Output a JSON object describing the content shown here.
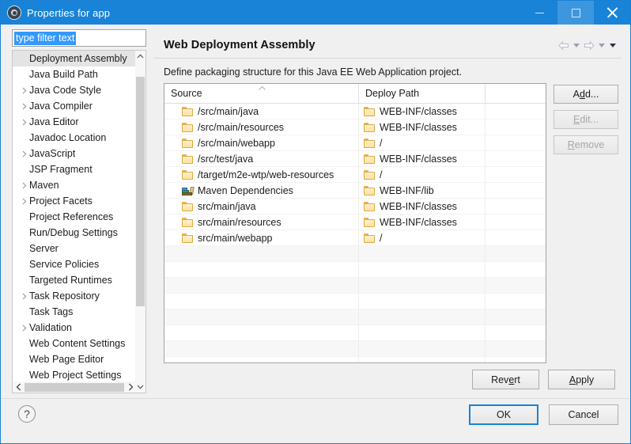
{
  "window": {
    "title": "Properties for app",
    "icon": "properties-gear-icon",
    "accent_color": "#1883d7",
    "buttons": {
      "minimize": "minimize",
      "maximize": "maximize",
      "close": "close"
    }
  },
  "filter": {
    "value": "type filter text",
    "placeholder": "type filter text"
  },
  "tree": {
    "items": [
      {
        "label": "Deployment Assembly",
        "expandable": false,
        "selected": true
      },
      {
        "label": "Java Build Path",
        "expandable": false,
        "selected": false
      },
      {
        "label": "Java Code Style",
        "expandable": true,
        "selected": false
      },
      {
        "label": "Java Compiler",
        "expandable": true,
        "selected": false
      },
      {
        "label": "Java Editor",
        "expandable": true,
        "selected": false
      },
      {
        "label": "Javadoc Location",
        "expandable": false,
        "selected": false
      },
      {
        "label": "JavaScript",
        "expandable": true,
        "selected": false
      },
      {
        "label": "JSP Fragment",
        "expandable": false,
        "selected": false
      },
      {
        "label": "Maven",
        "expandable": true,
        "selected": false
      },
      {
        "label": "Project Facets",
        "expandable": true,
        "selected": false
      },
      {
        "label": "Project References",
        "expandable": false,
        "selected": false
      },
      {
        "label": "Run/Debug Settings",
        "expandable": false,
        "selected": false
      },
      {
        "label": "Server",
        "expandable": false,
        "selected": false
      },
      {
        "label": "Service Policies",
        "expandable": false,
        "selected": false
      },
      {
        "label": "Targeted Runtimes",
        "expandable": false,
        "selected": false
      },
      {
        "label": "Task Repository",
        "expandable": true,
        "selected": false
      },
      {
        "label": "Task Tags",
        "expandable": false,
        "selected": false
      },
      {
        "label": "Validation",
        "expandable": true,
        "selected": false
      },
      {
        "label": "Web Content Settings",
        "expandable": false,
        "selected": false
      },
      {
        "label": "Web Page Editor",
        "expandable": false,
        "selected": false
      },
      {
        "label": "Web Project Settings",
        "expandable": false,
        "selected": false
      }
    ]
  },
  "page": {
    "title": "Web Deployment Assembly",
    "description": "Define packaging structure for this Java EE Web Application project.",
    "nav": {
      "back": "back-arrow-icon",
      "back_menu": "back-dropdown-icon",
      "forward": "forward-arrow-icon",
      "forward_menu": "forward-dropdown-icon",
      "view_menu": "view-menu-dropdown-icon"
    }
  },
  "table": {
    "columns": [
      "Source",
      "Deploy Path",
      ""
    ],
    "sorted_column": "Source",
    "sort_direction": "ascending",
    "rows": [
      {
        "source": "/src/main/java",
        "icon": "folder-icon",
        "deploy": "WEB-INF/classes"
      },
      {
        "source": "/src/main/resources",
        "icon": "folder-icon",
        "deploy": "WEB-INF/classes"
      },
      {
        "source": "/src/main/webapp",
        "icon": "folder-icon",
        "deploy": "/"
      },
      {
        "source": "/src/test/java",
        "icon": "folder-icon",
        "deploy": "WEB-INF/classes"
      },
      {
        "source": "/target/m2e-wtp/web-resources",
        "icon": "folder-icon",
        "deploy": "/"
      },
      {
        "source": "Maven Dependencies",
        "icon": "maven-dependencies-icon",
        "deploy": "WEB-INF/lib"
      },
      {
        "source": "src/main/java",
        "icon": "folder-icon",
        "deploy": "WEB-INF/classes"
      },
      {
        "source": "src/main/resources",
        "icon": "folder-icon",
        "deploy": "WEB-INF/classes"
      },
      {
        "source": "src/main/webapp",
        "icon": "folder-icon",
        "deploy": "/"
      }
    ],
    "empty_row_count": 8
  },
  "side_buttons": [
    {
      "label": "Add...",
      "mnemonic_index": 1,
      "enabled": true,
      "name": "add-button"
    },
    {
      "label": "Edit...",
      "mnemonic_index": 0,
      "enabled": false,
      "name": "edit-button"
    },
    {
      "label": "Remove",
      "mnemonic_index": 0,
      "enabled": false,
      "name": "remove-button"
    }
  ],
  "action_buttons": {
    "revert": "Revert",
    "revert_mnemonic_index": 3,
    "apply": "Apply",
    "apply_mnemonic_index": 0
  },
  "footer": {
    "help": "?",
    "ok": "OK",
    "cancel": "Cancel"
  }
}
